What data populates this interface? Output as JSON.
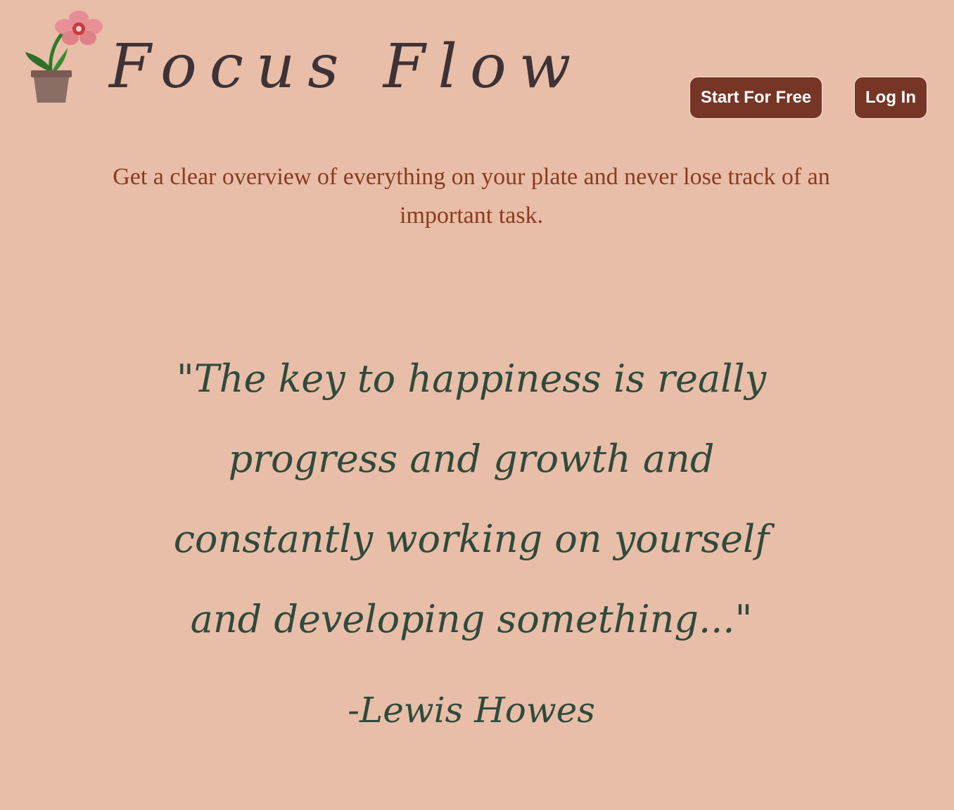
{
  "header": {
    "brand_title": "Focus Flow",
    "logo_icon": "orchid-plant-icon",
    "buttons": {
      "start_label": "Start For Free",
      "login_label": "Log In"
    }
  },
  "hero": {
    "tagline": "Get a clear overview of everything on your plate and never lose track of an important task."
  },
  "quote": {
    "text": "\"The key to happiness is really progress and growth and constantly working on yourself and developing something...\"",
    "author": "-Lewis Howes"
  },
  "colors": {
    "background": "#e8bea8",
    "button": "#763525",
    "tagline": "#8b3a22",
    "quote": "#2f4a3c",
    "title": "#3e3236"
  }
}
